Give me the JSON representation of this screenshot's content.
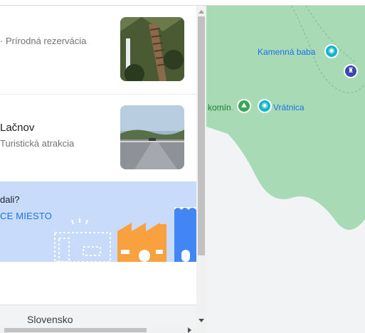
{
  "results": [
    {
      "subtitle": "· Prírodná rezervácia"
    },
    {
      "title": "Lačnov",
      "subtitle": "Turistická atrakcia"
    }
  ],
  "promo": {
    "question": "dali?",
    "link": "CE MIESTO"
  },
  "footer": {
    "country": "Slovensko"
  },
  "map": {
    "labels": {
      "kamenna_baba": "Kamenná baba",
      "komin": "komín",
      "vratnica": "Vrátnica"
    }
  },
  "colors": {
    "map_green": "#a8dab5",
    "map_water_route": "#9ccbcb",
    "promo_bg": "#c9dbfb",
    "link": "#1a73e8"
  },
  "icons": [
    "camera-pin-icon",
    "hiking-pin-icon",
    "landmark-pin-icon",
    "map-pin-icon"
  ]
}
